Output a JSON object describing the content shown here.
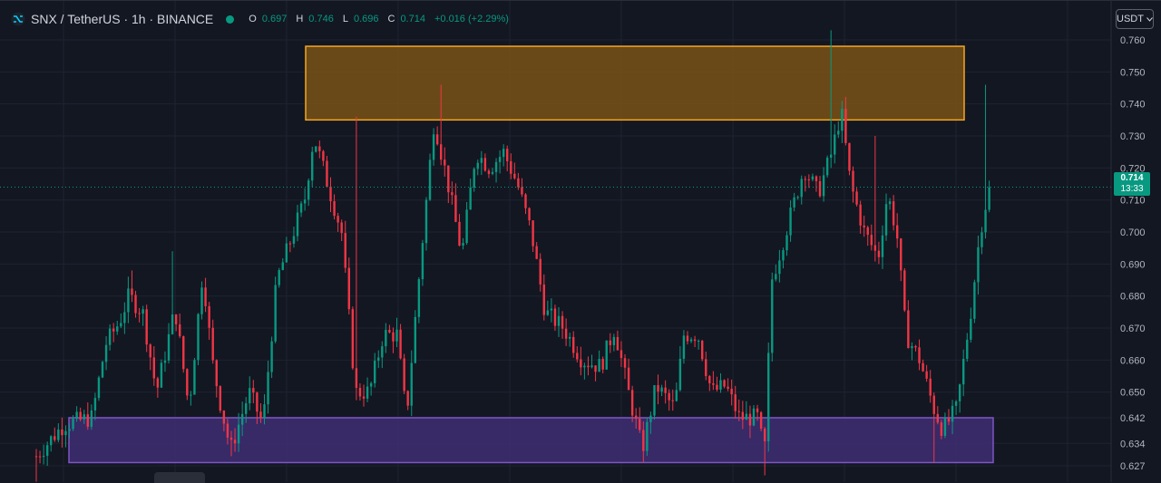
{
  "header": {
    "symbol": "SNX / TetherUS · 1h · BINANCE",
    "open_label": "O",
    "open": "0.697",
    "high_label": "H",
    "high": "0.746",
    "low_label": "L",
    "low": "0.696",
    "close_label": "C",
    "close": "0.714",
    "change": "+0.016 (+2.29%)"
  },
  "currency_selector": {
    "label": "USDT",
    "icon": "chevron-down-icon"
  },
  "last_price": {
    "price": "0.714",
    "countdown": "13:33"
  },
  "colors": {
    "background": "#131722",
    "up": "#089981",
    "down": "#f23645",
    "resistance_fill": "#7a5216",
    "resistance_border": "#f5a623",
    "support_fill": "#3f2d73",
    "support_border": "#7e57c2"
  },
  "chart_data": {
    "type": "candlestick",
    "symbol": "SNX / TetherUS",
    "interval": "1h",
    "exchange": "BINANCE",
    "ylim": [
      0.624,
      0.763
    ],
    "y_ticks": [
      "0.760",
      "0.750",
      "0.740",
      "0.730",
      "0.720",
      "0.710",
      "0.700",
      "0.690",
      "0.680",
      "0.670",
      "0.660",
      "0.650",
      "0.642",
      "0.634",
      "0.627"
    ],
    "last_price": 0.714,
    "zones": [
      {
        "kind": "resistance",
        "y_low": 0.735,
        "y_high": 0.758,
        "x_start_frac": 0.263,
        "x_end_frac": 0.832
      },
      {
        "kind": "support",
        "y_low": 0.628,
        "y_high": 0.642,
        "x_start_frac": 0.059,
        "x_end_frac": 0.856
      }
    ],
    "price_path": [
      [
        0.0,
        0.63
      ],
      [
        0.03,
        0.64
      ],
      [
        0.06,
        0.642
      ],
      [
        0.075,
        0.665
      ],
      [
        0.09,
        0.672
      ],
      [
        0.1,
        0.68
      ],
      [
        0.115,
        0.675
      ],
      [
        0.13,
        0.65
      ],
      [
        0.15,
        0.676
      ],
      [
        0.165,
        0.645
      ],
      [
        0.18,
        0.688
      ],
      [
        0.19,
        0.66
      ],
      [
        0.2,
        0.645
      ],
      [
        0.21,
        0.632
      ],
      [
        0.23,
        0.65
      ],
      [
        0.245,
        0.64
      ],
      [
        0.26,
        0.685
      ],
      [
        0.29,
        0.71
      ],
      [
        0.3,
        0.73
      ],
      [
        0.315,
        0.715
      ],
      [
        0.33,
        0.7
      ],
      [
        0.345,
        0.65
      ],
      [
        0.36,
        0.65
      ],
      [
        0.375,
        0.668
      ],
      [
        0.39,
        0.668
      ],
      [
        0.4,
        0.642
      ],
      [
        0.415,
        0.69
      ],
      [
        0.43,
        0.735
      ],
      [
        0.445,
        0.715
      ],
      [
        0.46,
        0.693
      ],
      [
        0.475,
        0.725
      ],
      [
        0.49,
        0.72
      ],
      [
        0.505,
        0.725
      ],
      [
        0.52,
        0.715
      ],
      [
        0.535,
        0.7
      ],
      [
        0.55,
        0.675
      ],
      [
        0.57,
        0.67
      ],
      [
        0.59,
        0.66
      ],
      [
        0.61,
        0.658
      ],
      [
        0.625,
        0.67
      ],
      [
        0.64,
        0.65
      ],
      [
        0.655,
        0.632
      ],
      [
        0.67,
        0.652
      ],
      [
        0.69,
        0.645
      ],
      [
        0.7,
        0.668
      ],
      [
        0.715,
        0.668
      ],
      [
        0.73,
        0.65
      ],
      [
        0.745,
        0.652
      ],
      [
        0.76,
        0.642
      ],
      [
        0.78,
        0.642
      ],
      [
        0.787,
        0.63
      ],
      [
        0.795,
        0.685
      ],
      [
        0.81,
        0.7
      ],
      [
        0.83,
        0.72
      ],
      [
        0.845,
        0.712
      ],
      [
        0.86,
        0.725
      ],
      [
        0.87,
        0.738
      ],
      [
        0.88,
        0.715
      ],
      [
        0.895,
        0.7
      ],
      [
        0.91,
        0.692
      ],
      [
        0.92,
        0.712
      ],
      [
        0.93,
        0.7
      ],
      [
        0.94,
        0.668
      ],
      [
        0.955,
        0.66
      ],
      [
        0.97,
        0.645
      ],
      [
        0.98,
        0.638
      ],
      [
        0.995,
        0.645
      ],
      [
        1.01,
        0.675
      ],
      [
        1.02,
        0.7
      ],
      [
        1.03,
        0.714
      ]
    ],
    "high_spikes": [
      [
        0.86,
        0.763
      ],
      [
        0.87,
        0.74
      ],
      [
        0.905,
        0.73
      ],
      [
        0.345,
        0.736
      ],
      [
        0.437,
        0.746
      ],
      [
        0.146,
        0.694
      ],
      [
        0.102,
        0.688
      ],
      [
        1.025,
        0.746
      ]
    ],
    "low_spikes": [
      [
        0.787,
        0.624
      ],
      [
        0.21,
        0.63
      ],
      [
        0.655,
        0.628
      ],
      [
        0.97,
        0.628
      ],
      [
        0.0,
        0.622
      ]
    ]
  }
}
